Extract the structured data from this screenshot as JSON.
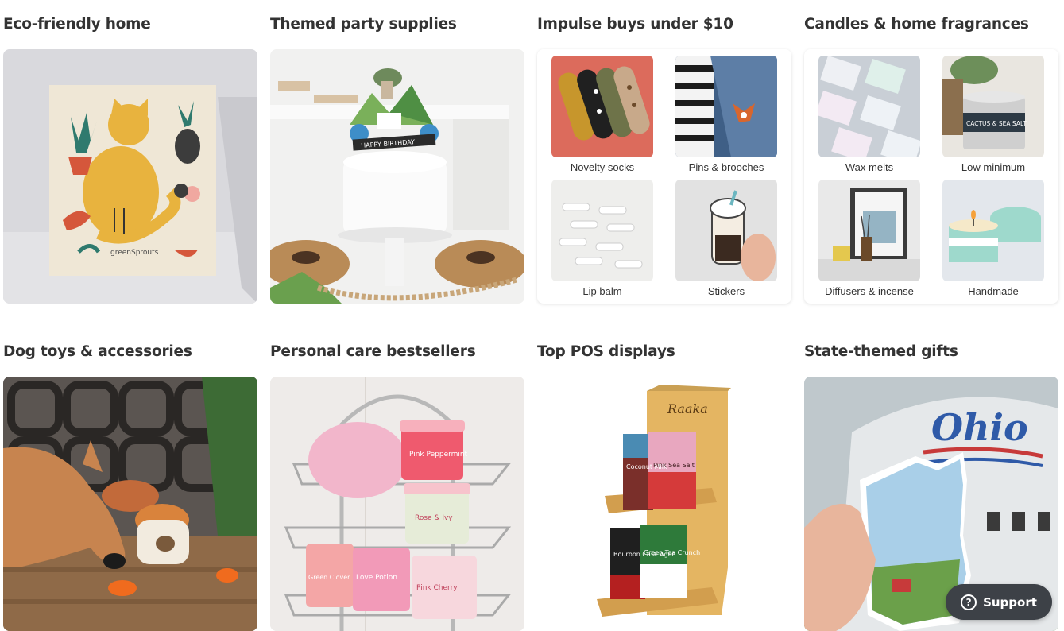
{
  "sections": [
    {
      "title": "Eco-friendly home"
    },
    {
      "title": "Themed party supplies"
    },
    {
      "title": "Impulse buys under $10",
      "items": [
        {
          "label": "Novelty socks"
        },
        {
          "label": "Pins & brooches"
        },
        {
          "label": "Lip balm"
        },
        {
          "label": "Stickers"
        }
      ]
    },
    {
      "title": "Candles & home fragrances",
      "items": [
        {
          "label": "Wax melts"
        },
        {
          "label": "Low minimum"
        },
        {
          "label": "Diffusers & incense"
        },
        {
          "label": "Handmade"
        }
      ]
    },
    {
      "title": "Dog toys & accessories"
    },
    {
      "title": "Personal care bestsellers"
    },
    {
      "title": "Top POS displays"
    },
    {
      "title": "State-themed gifts"
    }
  ],
  "image_text": {
    "birthday_banner": "HAPPY BIRTHDAY",
    "sponge_brand": "greenSprouts",
    "raaka_brand": "Raaka",
    "bar1": "Coconut Milk",
    "bar2": "Pink Sea Salt",
    "bar3": "Bourbon Cask Aged",
    "bar4": "Green Tea Crunch",
    "candle_label": "CACTUS & SEA SALT",
    "ohio_sign": "Ohio",
    "jar1": "Pink Peppermint",
    "jar2": "Rose & Ivy",
    "jar3": "Love Potion",
    "jar4": "Pink Cherry",
    "jar5": "Green Clover"
  },
  "support": {
    "label": "Support",
    "icon": "question-icon"
  },
  "colors": {
    "title_text": "#333333",
    "support_bg": "#3d4147",
    "support_text": "#ffffff"
  }
}
